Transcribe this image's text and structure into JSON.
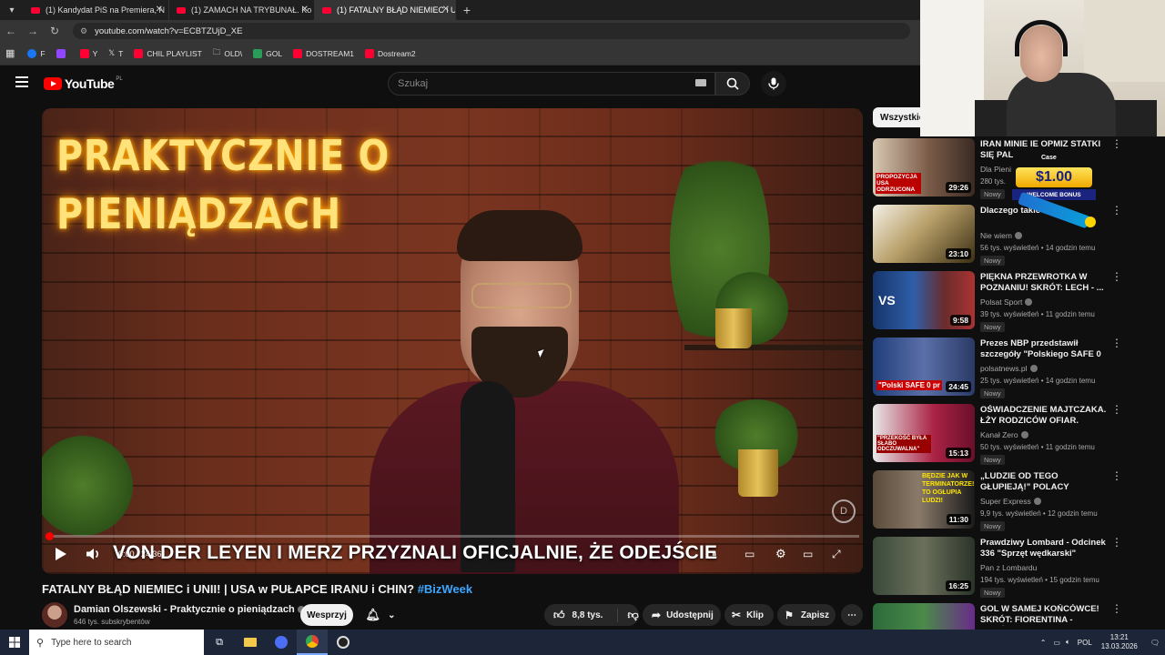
{
  "browser": {
    "tabs": [
      {
        "title": "(1) Kandydat PiS na Premiera, N",
        "active": false
      },
      {
        "title": "(1) ZAMACH NA TRYBUNAŁ. Ko",
        "active": false
      },
      {
        "title": "(1) FATALNY BŁĄD NIEMIEC i UN",
        "active": true
      }
    ],
    "url": "youtube.com/watch?v=ECBTZUjD_XE",
    "bookmarks": [
      "F",
      "",
      "Y",
      "T",
      "CHIL PLAYLIST",
      "OLD\\",
      "GOL",
      "DOSTREAM1",
      "Dostream2"
    ]
  },
  "youtube": {
    "logo_text": "YouTube",
    "country_code": "PL",
    "search_placeholder": "Szukaj"
  },
  "video": {
    "neon_line1": "PRAKTYCZNIE O",
    "neon_line2": "PIENIĄDZACH",
    "overlay_caption": "VON DER LEYEN I MERZ PRZYZNALI OFICJALNIE, ŻE ODEJŚCIE",
    "time": "0:00 / 24:36",
    "progress_fraction": 0.0,
    "title_main": "FATALNY BŁĄD NIEMIEC i UNII! | USA w PUŁAPCE IRANU i CHIN?",
    "title_tag": "#BizWeek",
    "channel_name": "Damian Olszewski - Praktycznie o pieniądzach",
    "channel_subs": "646 tys. subskrybentów",
    "support_label": "Wesprzyj",
    "likes": "8,8 tys.",
    "share_label": "Udostępnij",
    "clip_label": "Klip",
    "save_label": "Zapisz"
  },
  "sidebar": {
    "chip_label": "Wszystkie",
    "items": [
      {
        "title": "IRAN MINIE IE OPMIZ STATKI SIĘ PAL",
        "channel": "Dla Pieni",
        "meta": "280 tys.",
        "badge": "Nowy",
        "duration": "29:26",
        "thumb_text": "PROPOZYCJA USA ODRZUCONA"
      },
      {
        "title": "Dlaczego takie dr",
        "channel": "Nie wiem",
        "meta": "56 tys. wyświetleń • 14 godzin temu",
        "badge": "Nowy",
        "duration": "23:10",
        "thumb_text": ""
      },
      {
        "title": "PIĘKNA PRZEWROTKA W POZNANIU! SKRÓT: LECH - ...",
        "channel": "Polsat Sport",
        "meta": "39 tys. wyświetleń • 11 godzin temu",
        "badge": "Nowy",
        "duration": "9:58",
        "thumb_text": "VS"
      },
      {
        "title": "Prezes NBP przedstawił szczegóły \"Polskiego SAFE 0 ...",
        "channel": "polsatnews.pl",
        "meta": "25 tys. wyświetleń • 14 godzin temu",
        "badge": "Nowy",
        "duration": "24:45",
        "thumb_text": "\"Polski SAFE 0 pr"
      },
      {
        "title": "OŚWIADCZENIE MAJTCZAKA. ŁŻY RODZICÓW OFIAR. NOWY...",
        "channel": "Kanał Zero",
        "meta": "50 tys. wyświetleń • 11 godzin temu",
        "badge": "Nowy",
        "duration": "15:13",
        "thumb_text": "\"PRZEKOŚĆ BYŁA SŁABO ODCZUWALNA\""
      },
      {
        "title": "„LUDZIE OD TEGO GŁUPIEJĄ!” POLACY PRZERAŻENI ...",
        "channel": "Super Express",
        "meta": "9,9 tys. wyświetleń • 12 godzin temu",
        "badge": "Nowy",
        "duration": "11:30",
        "thumb_text": "BĘDZIE JAK W TERMINATORZE! TO OGŁUPIA LUDZI!"
      },
      {
        "title": "Prawdziwy Lombard - Odcinek 336 \"Sprzęt wędkarski\"",
        "channel": "Pan z Lombardu",
        "meta": "194 tys. wyświetleń • 15 godzin temu",
        "badge": "Nowy",
        "duration": "16:25",
        "thumb_text": ""
      },
      {
        "title": "GOL W SAMEJ KOŃCÓWCE! SKRÓT: FIORENTINA - RAKÓW...",
        "channel": "",
        "meta": "",
        "badge": "",
        "duration": "",
        "thumb_text": ""
      }
    ]
  },
  "ad": {
    "amount": "$1.00",
    "label": "WELCOME BONUS",
    "brand": "Case"
  },
  "taskbar": {
    "search_placeholder": "Type here to search",
    "lang": "POL",
    "time": "13:21",
    "date": "13.03.2026"
  },
  "colors": {
    "accent": "#ff0000",
    "tag": "#3ea6ff",
    "bg": "#0f0f0f"
  }
}
